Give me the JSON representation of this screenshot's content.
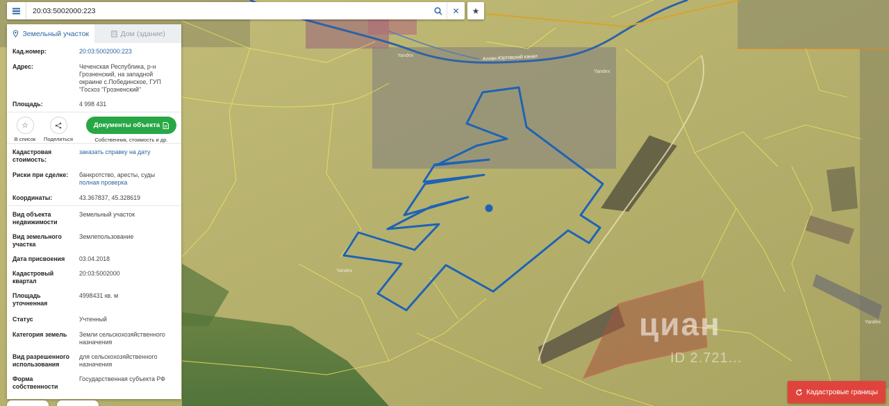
{
  "search": {
    "value": "20:03:5002000:223"
  },
  "tabs": [
    {
      "label": "Земельный участок"
    },
    {
      "label": "Дом (здание)"
    }
  ],
  "info": {
    "cad_number": {
      "label": "Кад.номер:",
      "value": "20:03:5002000:223"
    },
    "address": {
      "label": "Адрес:",
      "value": "Чеченская Республика, р-н Грозненский, на западной окраине с.Побединское, ГУП \"Госхоз \"Грозненский\""
    },
    "area": {
      "label": "Площадь:",
      "value": "4 998 431"
    },
    "cad_value": {
      "label": "Кадастровая стоимость:",
      "value": "заказать справку на дату"
    },
    "risks": {
      "label": "Риски при сделке:",
      "value": "банкротство, аресты, суды",
      "link": "полная проверка"
    },
    "coords": {
      "label": "Координаты:",
      "value": "43.367837, 45.328619"
    },
    "object_type": {
      "label": "Вид объекта недвижимости",
      "value": "Земельный участок"
    },
    "land_type": {
      "label": "Вид земельного участка",
      "value": "Землепользование"
    },
    "assign_date": {
      "label": "Дата присвоения",
      "value": "03.04.2018"
    },
    "quarter": {
      "label": "Кадастровый квартал",
      "value": "20:03:5002000"
    },
    "precise_area": {
      "label": "Площадь уточненная",
      "value": "4998431 кв. м"
    },
    "status": {
      "label": "Статус",
      "value": "Учтенный"
    },
    "category": {
      "label": "Категория земель",
      "value": "Земли сельскохозяйственного назначения"
    },
    "permitted_use": {
      "label": "Вид разрешенного использования",
      "value": "для сельскохозяйственного назначения"
    },
    "ownership": {
      "label": "Форма собственности",
      "value": "Государственная субъекта РФ"
    }
  },
  "actions": {
    "list_label": "В список",
    "share_label": "Поделиться",
    "docs_button": "Документы объекта",
    "docs_caption": "Собственник, стоимость и др."
  },
  "map": {
    "cadastral_button": "Кадастровые границы",
    "road_label": "Алхан-Юртовский канал",
    "yandex_labels": [
      "Yandex",
      "Yandex",
      "Yandex",
      "Yandex"
    ]
  },
  "watermark": {
    "brand": "циан",
    "id": "ID 2.721..."
  },
  "colors": {
    "accent": "#2a64a3",
    "green": "#28a745",
    "red": "#e0433c",
    "parcel": "#1d63b5"
  }
}
